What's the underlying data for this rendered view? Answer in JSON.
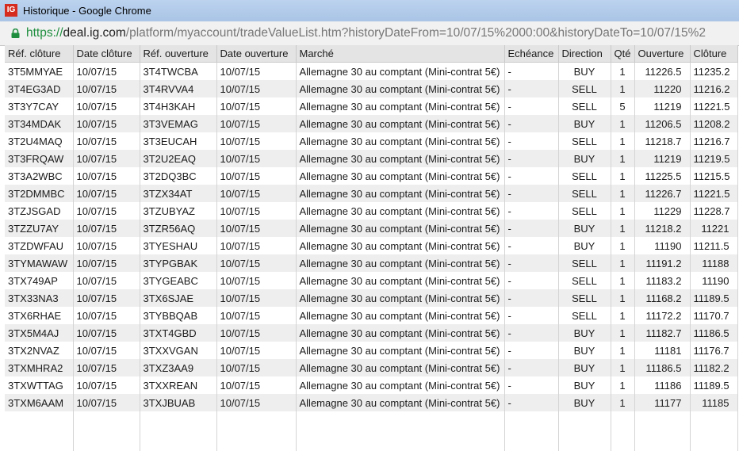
{
  "window": {
    "logo": "IG",
    "title": "Historique - Google Chrome"
  },
  "address_bar": {
    "scheme": "https://",
    "host": "deal.ig.com",
    "path": "/platform/myaccount/tradeValueList.htm?historyDateFrom=10/07/15%2000:00&historyDateTo=10/07/15%2"
  },
  "table": {
    "columns": [
      "Réf. clôture",
      "Date clôture",
      "Réf. ouverture",
      "Date ouverture",
      "Marché",
      "Echéance",
      "Direction",
      "Qté",
      "Ouverture",
      "Clôture"
    ],
    "rows": [
      [
        "3T5MMYAE",
        "10/07/15",
        "3T4TWCBA",
        "10/07/15",
        "Allemagne 30 au comptant (Mini-contrat 5€)",
        "-",
        "BUY",
        "1",
        "11226.5",
        "11235.2"
      ],
      [
        "3T4EG3AD",
        "10/07/15",
        "3T4RVVA4",
        "10/07/15",
        "Allemagne 30 au comptant (Mini-contrat 5€)",
        "-",
        "SELL",
        "1",
        "11220",
        "11216.2"
      ],
      [
        "3T3Y7CAY",
        "10/07/15",
        "3T4H3KAH",
        "10/07/15",
        "Allemagne 30 au comptant (Mini-contrat 5€)",
        "-",
        "SELL",
        "5",
        "11219",
        "11221.5"
      ],
      [
        "3T34MDAK",
        "10/07/15",
        "3T3VEMAG",
        "10/07/15",
        "Allemagne 30 au comptant (Mini-contrat 5€)",
        "-",
        "BUY",
        "1",
        "11206.5",
        "11208.2"
      ],
      [
        "3T2U4MAQ",
        "10/07/15",
        "3T3EUCAH",
        "10/07/15",
        "Allemagne 30 au comptant (Mini-contrat 5€)",
        "-",
        "SELL",
        "1",
        "11218.7",
        "11216.7"
      ],
      [
        "3T3FRQAW",
        "10/07/15",
        "3T2U2EAQ",
        "10/07/15",
        "Allemagne 30 au comptant (Mini-contrat 5€)",
        "-",
        "BUY",
        "1",
        "11219",
        "11219.5"
      ],
      [
        "3T3A2WBC",
        "10/07/15",
        "3T2DQ3BC",
        "10/07/15",
        "Allemagne 30 au comptant (Mini-contrat 5€)",
        "-",
        "SELL",
        "1",
        "11225.5",
        "11215.5"
      ],
      [
        "3T2DMMBC",
        "10/07/15",
        "3TZX34AT",
        "10/07/15",
        "Allemagne 30 au comptant (Mini-contrat 5€)",
        "-",
        "SELL",
        "1",
        "11226.7",
        "11221.5"
      ],
      [
        "3TZJSGAD",
        "10/07/15",
        "3TZUBYAZ",
        "10/07/15",
        "Allemagne 30 au comptant (Mini-contrat 5€)",
        "-",
        "SELL",
        "1",
        "11229",
        "11228.7"
      ],
      [
        "3TZZU7AY",
        "10/07/15",
        "3TZR56AQ",
        "10/07/15",
        "Allemagne 30 au comptant (Mini-contrat 5€)",
        "-",
        "BUY",
        "1",
        "11218.2",
        "11221"
      ],
      [
        "3TZDWFAU",
        "10/07/15",
        "3TYESHAU",
        "10/07/15",
        "Allemagne 30 au comptant (Mini-contrat 5€)",
        "-",
        "BUY",
        "1",
        "11190",
        "11211.5"
      ],
      [
        "3TYMAWAW",
        "10/07/15",
        "3TYPGBAK",
        "10/07/15",
        "Allemagne 30 au comptant (Mini-contrat 5€)",
        "-",
        "SELL",
        "1",
        "11191.2",
        "11188"
      ],
      [
        "3TX749AP",
        "10/07/15",
        "3TYGEABC",
        "10/07/15",
        "Allemagne 30 au comptant (Mini-contrat 5€)",
        "-",
        "SELL",
        "1",
        "11183.2",
        "11190"
      ],
      [
        "3TX33NA3",
        "10/07/15",
        "3TX6SJAE",
        "10/07/15",
        "Allemagne 30 au comptant (Mini-contrat 5€)",
        "-",
        "SELL",
        "1",
        "11168.2",
        "11189.5"
      ],
      [
        "3TX6RHAE",
        "10/07/15",
        "3TYBBQAB",
        "10/07/15",
        "Allemagne 30 au comptant (Mini-contrat 5€)",
        "-",
        "SELL",
        "1",
        "11172.2",
        "11170.7"
      ],
      [
        "3TX5M4AJ",
        "10/07/15",
        "3TXT4GBD",
        "10/07/15",
        "Allemagne 30 au comptant (Mini-contrat 5€)",
        "-",
        "BUY",
        "1",
        "11182.7",
        "11186.5"
      ],
      [
        "3TX2NVAZ",
        "10/07/15",
        "3TXXVGAN",
        "10/07/15",
        "Allemagne 30 au comptant (Mini-contrat 5€)",
        "-",
        "BUY",
        "1",
        "11181",
        "11176.7"
      ],
      [
        "3TXMHRA2",
        "10/07/15",
        "3TXZ3AA9",
        "10/07/15",
        "Allemagne 30 au comptant (Mini-contrat 5€)",
        "-",
        "BUY",
        "1",
        "11186.5",
        "11182.2"
      ],
      [
        "3TXWTTAG",
        "10/07/15",
        "3TXXREAN",
        "10/07/15",
        "Allemagne 30 au comptant (Mini-contrat 5€)",
        "-",
        "BUY",
        "1",
        "11186",
        "11189.5"
      ],
      [
        "3TXM6AAM",
        "10/07/15",
        "3TXJBUAB",
        "10/07/15",
        "Allemagne 30 au comptant (Mini-contrat 5€)",
        "-",
        "BUY",
        "1",
        "11177",
        "11185"
      ]
    ]
  }
}
